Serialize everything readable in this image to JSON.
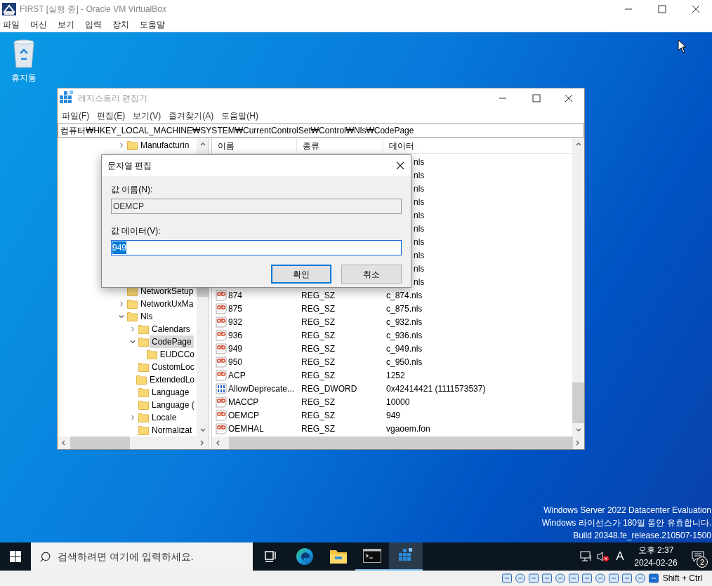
{
  "vbox": {
    "title": "FIRST [실행 중] - Oracle VM VirtualBox",
    "menu": [
      "파일",
      "머신",
      "보기",
      "입력",
      "장치",
      "도움말"
    ],
    "host_key": "Shift + Ctrl"
  },
  "desktop": {
    "icons": [
      {
        "label": "휴지통"
      }
    ],
    "watermark_lines": [
      "Windows Server 2022 Datacenter Evaluation",
      "Windows 라이선스가 180일 동안 유효합니다.",
      "Build 20348.fe_release.210507-1500"
    ]
  },
  "regedit": {
    "title": "레지스트리 편집기",
    "menu": [
      "파일(F)",
      "편집(E)",
      "보기(V)",
      "즐겨찾기(A)",
      "도움말(H)"
    ],
    "address": "컴퓨터₩HKEY_LOCAL_MACHINE₩SYSTEM₩CurrentControlSet₩Control₩Nls₩CodePage",
    "tree_top": [
      {
        "label": "Manufacturin",
        "expanded": false,
        "selected": false
      }
    ],
    "tree": [
      {
        "label": "NetworkSetup",
        "selected": false
      },
      {
        "label": "NetworkUxMa",
        "expanded": false,
        "selected": false
      },
      {
        "label": "Nls",
        "expanded": true,
        "selected": false,
        "children": [
          {
            "label": "Calendars",
            "expanded": false,
            "selected": false
          },
          {
            "label": "CodePage",
            "expanded": true,
            "selected": true,
            "children": [
              {
                "label": "EUDCCo",
                "selected": false
              }
            ]
          },
          {
            "label": "CustomLoc",
            "selected": false
          },
          {
            "label": "ExtendedLo",
            "selected": false
          },
          {
            "label": "Language",
            "selected": false
          },
          {
            "label": "Language (",
            "selected": false
          },
          {
            "label": "Locale",
            "expanded": false,
            "selected": false
          },
          {
            "label": "Normalizat",
            "selected": false
          }
        ]
      }
    ],
    "columns": [
      "이름",
      "종류",
      "데이터"
    ],
    "rows": [
      {
        "data": "nls"
      },
      {
        "data": "nls"
      },
      {
        "data": "nls"
      },
      {
        "data": "nls"
      },
      {
        "data": "nls"
      },
      {
        "data": "nls"
      },
      {
        "data": "nls"
      },
      {
        "data": "nls"
      },
      {
        "data": "nls"
      },
      {
        "data": "nls"
      },
      {
        "kind": "string",
        "name": "874",
        "type": "REG_SZ",
        "data": "c_874.nls"
      },
      {
        "kind": "string",
        "name": "875",
        "type": "REG_SZ",
        "data": "c_875.nls"
      },
      {
        "kind": "string",
        "name": "932",
        "type": "REG_SZ",
        "data": "c_932.nls"
      },
      {
        "kind": "string",
        "name": "936",
        "type": "REG_SZ",
        "data": "c_936.nls"
      },
      {
        "kind": "string",
        "name": "949",
        "type": "REG_SZ",
        "data": "c_949.nls"
      },
      {
        "kind": "string",
        "name": "950",
        "type": "REG_SZ",
        "data": "c_950.nls"
      },
      {
        "kind": "string",
        "name": "ACP",
        "type": "REG_SZ",
        "data": "1252"
      },
      {
        "kind": "dword",
        "name": "AllowDeprecate...",
        "type": "REG_DWORD",
        "data": "0x42414421 (1111573537)"
      },
      {
        "kind": "string",
        "name": "MACCP",
        "type": "REG_SZ",
        "data": "10000"
      },
      {
        "kind": "string",
        "name": "OEMCP",
        "type": "REG_SZ",
        "data": "949"
      },
      {
        "kind": "string",
        "name": "OEMHAL",
        "type": "REG_SZ",
        "data": "vgaoem.fon"
      }
    ]
  },
  "dialog": {
    "title": "문자열 편집",
    "name_label": "값 이름(N):",
    "name_value": "OEMCP",
    "data_label": "값 데이터(V):",
    "data_value": "949",
    "data_selected": true,
    "buttons": [
      {
        "label": "확인",
        "default": true
      },
      {
        "label": "취소",
        "default": false
      }
    ]
  },
  "taskbar": {
    "search_placeholder": "검색하려면 여기에 입력하세요.",
    "apps": [
      {
        "kind": "task-view",
        "running": false,
        "active": false
      },
      {
        "kind": "browser",
        "running": false,
        "active": false
      },
      {
        "kind": "folder",
        "running": false,
        "active": false
      },
      {
        "kind": "terminal",
        "running": true,
        "active": false
      },
      {
        "kind": "registry",
        "running": true,
        "active": true
      }
    ],
    "input_indicator": "A",
    "time": "오후 2:37",
    "date": "2024-02-26",
    "notification_count": "2"
  }
}
